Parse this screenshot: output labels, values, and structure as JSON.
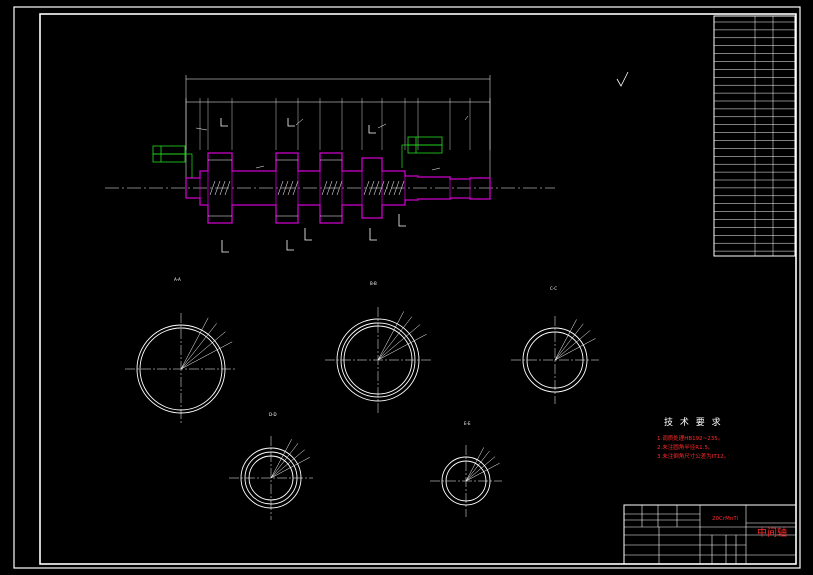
{
  "tech": {
    "heading": "技 术 要 求",
    "items": [
      "1.",
      "2.",
      "3."
    ],
    "notes": [
      "1.调质处理HB192~235。",
      "2.未注圆角半径R1.5。",
      "3.未注倒角尺寸公差为IT12。"
    ]
  },
  "title_block": {
    "part_name": "中间轴",
    "material": "20CrMnTi"
  },
  "sections": {
    "a": "A-A",
    "b": "B-B",
    "c": "C-C",
    "d": "D-D",
    "e": "E-E"
  },
  "colors": {
    "background": "#000000",
    "line": "#ffffff",
    "shaft": "#cc00cc",
    "tolerance": "#22dd22",
    "notes": "#ff2a2a",
    "dimension": "#ffffff"
  }
}
